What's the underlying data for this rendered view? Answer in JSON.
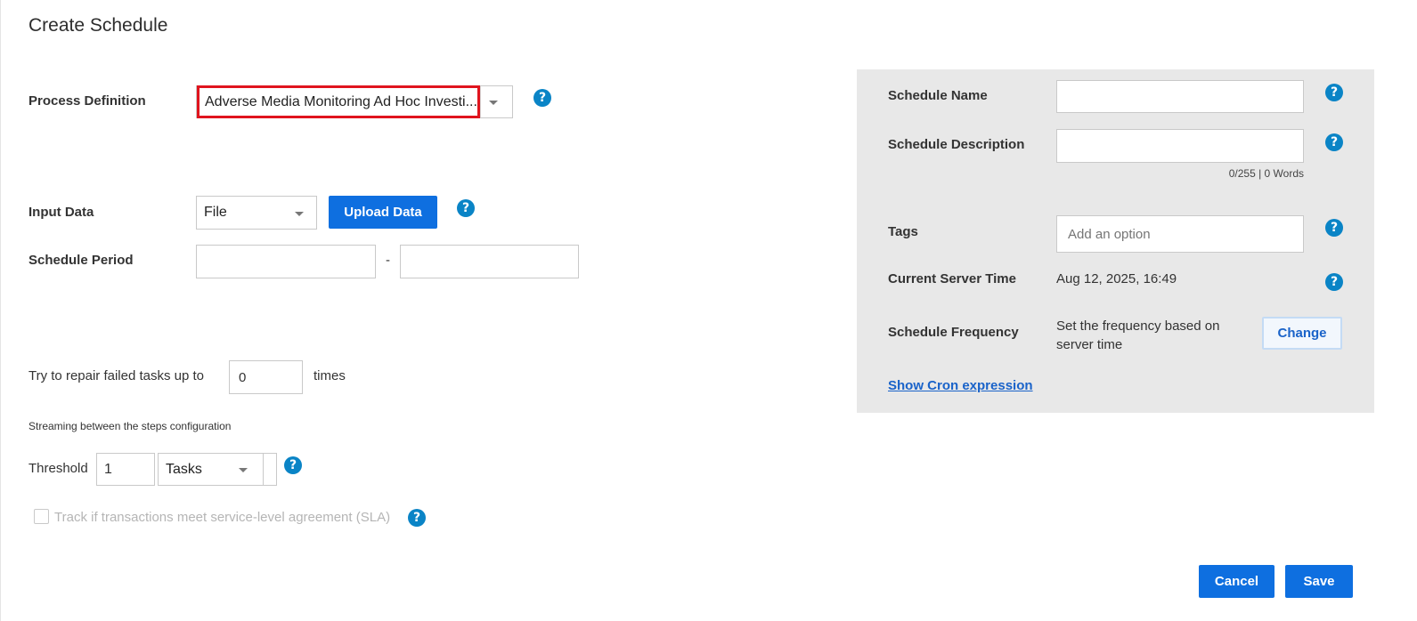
{
  "dialog": {
    "title": "Create Schedule"
  },
  "process_definition": {
    "label": "Process Definition",
    "value": "Adverse Media Monitoring Ad Hoc Investi..."
  },
  "input_data": {
    "label": "Input Data",
    "selected": "File",
    "upload_label": "Upload Data"
  },
  "schedule_period": {
    "label": "Schedule Period",
    "separator": "-",
    "start_value": "",
    "end_value": ""
  },
  "repair": {
    "prefix": "Try to repair failed tasks up to",
    "value": "0",
    "suffix": "times"
  },
  "streaming": {
    "heading": "Streaming between the steps configuration",
    "threshold_label": "Threshold",
    "threshold_value": "1",
    "unit": "Tasks"
  },
  "sla": {
    "label": "Track if transactions meet service-level agreement (SLA)",
    "checked": false
  },
  "panel": {
    "schedule_name": {
      "label": "Schedule Name",
      "value": ""
    },
    "schedule_description": {
      "label": "Schedule Description",
      "value": "",
      "counter": "0/255 | 0 Words"
    },
    "tags": {
      "label": "Tags",
      "placeholder": "Add an option"
    },
    "server_time": {
      "label": "Current Server Time",
      "value": "Aug 12, 2025, 16:49"
    },
    "frequency": {
      "label": "Schedule Frequency",
      "text_line1": "Set the frequency based on",
      "text_line2": "server time",
      "change_label": "Change"
    },
    "cron_link": "Show Cron expression"
  },
  "footer": {
    "cancel_label": "Cancel",
    "save_label": "Save"
  },
  "help_glyph": "?",
  "colors": {
    "primary": "#0e6fe0",
    "help": "#0a84c6",
    "highlight_border": "#e0141e",
    "panel_bg": "#e8e8e8",
    "link": "#1a63c9"
  }
}
